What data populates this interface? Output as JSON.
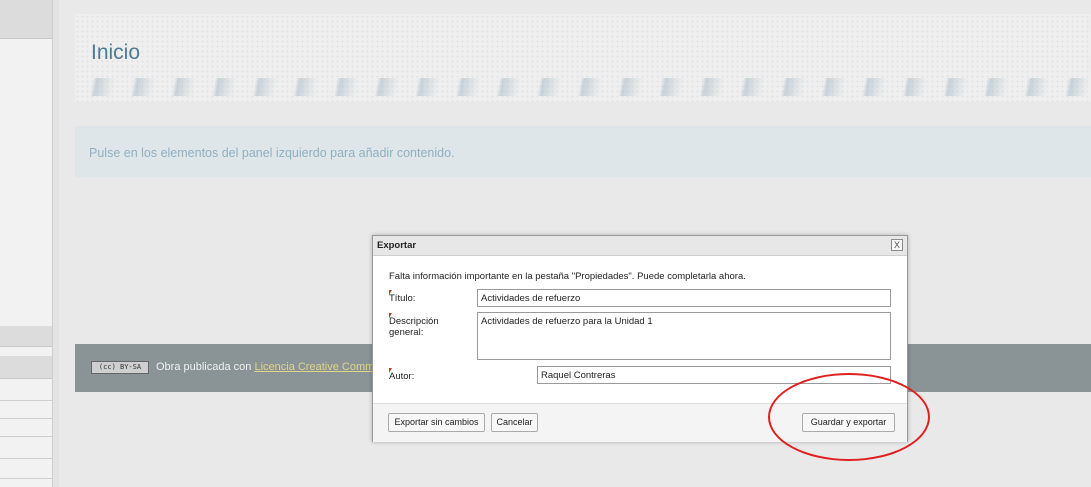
{
  "page": {
    "title": "Inicio",
    "info_text": "Pulse en los elementos del panel izquierdo para añadir contenido."
  },
  "footer": {
    "license_badge": "BY-SA",
    "text": "Obra publicada con ",
    "link": "Licencia Creative Comm"
  },
  "dialog": {
    "title": "Exportar",
    "close_label": "X",
    "message": "Falta información importante en la pestaña \"Propiedades\". Puede completarla ahora.",
    "titulo_label": "Título:",
    "titulo_value": "Actividades de refuerzo",
    "descripcion_label": "Descripción general:",
    "descripcion_value": "Actividades de refuerzo para la Unidad 1",
    "autor_label": "Autor:",
    "autor_value": "Raquel Contreras",
    "buttons": {
      "export_no_changes": "Exportar sin cambios",
      "cancel": "Cancelar",
      "save_export": "Guardar y exportar"
    }
  },
  "colors": {
    "title": "#4f7a93",
    "info_bg": "#dfe6ea",
    "footer_bg": "#8a9496",
    "highlight": "#e02020"
  }
}
